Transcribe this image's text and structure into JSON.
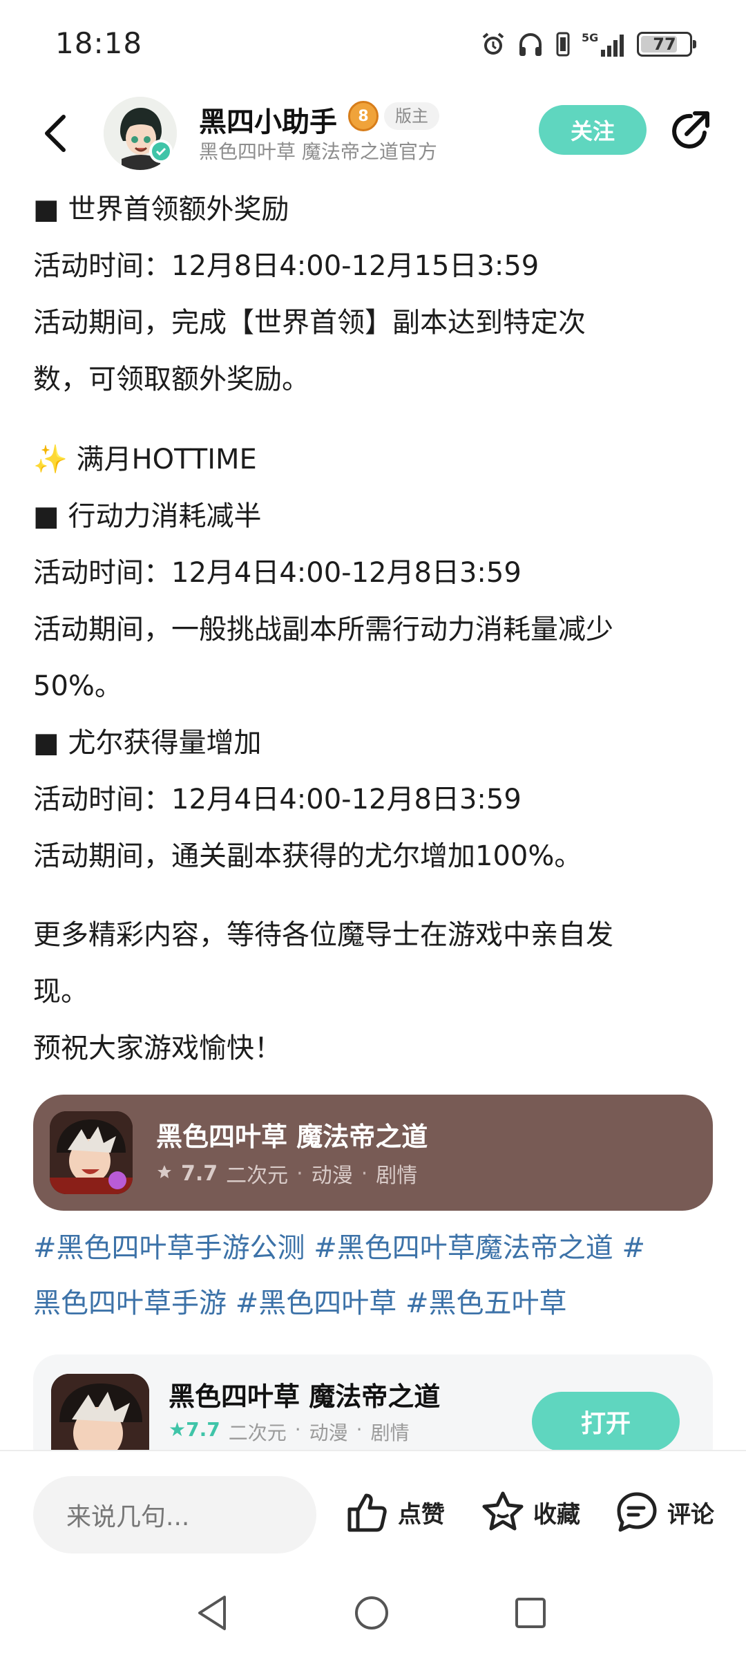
{
  "status_bar": {
    "time": "18:18",
    "network": "5G",
    "battery": "77",
    "battery_level_percent": 77,
    "icons": [
      "alarm-icon",
      "headphones-icon",
      "vibrate-icon",
      "signal-icon",
      "battery-icon"
    ]
  },
  "header": {
    "username": "黑四小助手",
    "level_badge": "8",
    "role_badge": "版主",
    "subtitle": "黑色四叶草 魔法帝之道官方",
    "follow_label": "关注",
    "accent_color": "#5fd6bf"
  },
  "article": {
    "lines": [
      "■ 世界首领额外奖励",
      "活动时间：12月8日4:00-12月15日3:59",
      "活动期间，完成【世界首领】副本达到特定次",
      "数，可领取额外奖励。",
      "✨ 满月HOTTIME",
      "■ 行动力消耗减半",
      "活动时间：12月4日4:00-12月8日3:59",
      "活动期间，一般挑战副本所需行动力消耗量减少",
      "50%。",
      "■ 尤尔获得量增加",
      "活动时间：12月4日4:00-12月8日3:59",
      "活动期间，通关副本获得的尤尔增加100%。",
      "更多精彩内容，等待各位魔导士在游戏中亲自发",
      "现。",
      "预祝大家游戏愉快！"
    ]
  },
  "game_card": {
    "title": "黑色四叶草 魔法帝之道",
    "score": "7.7",
    "genres": [
      "二次元",
      "动漫",
      "剧情"
    ],
    "bg_color": "#785b55"
  },
  "tags": {
    "line1": "#黑色四叶草手游公测 #黑色四叶草魔法帝之道 #",
    "line2": "黑色四叶草手游 #黑色四叶草 #黑色五叶草"
  },
  "app_card": {
    "title": "黑色四叶草 魔法帝之道",
    "score": "7.7",
    "genres": [
      "二次元",
      "动漫",
      "剧情"
    ],
    "open_label": "打开"
  },
  "bottom_bar": {
    "comment_placeholder": "来说几句...",
    "like_label": "点赞",
    "favorite_label": "收藏",
    "comment_label": "评论"
  }
}
